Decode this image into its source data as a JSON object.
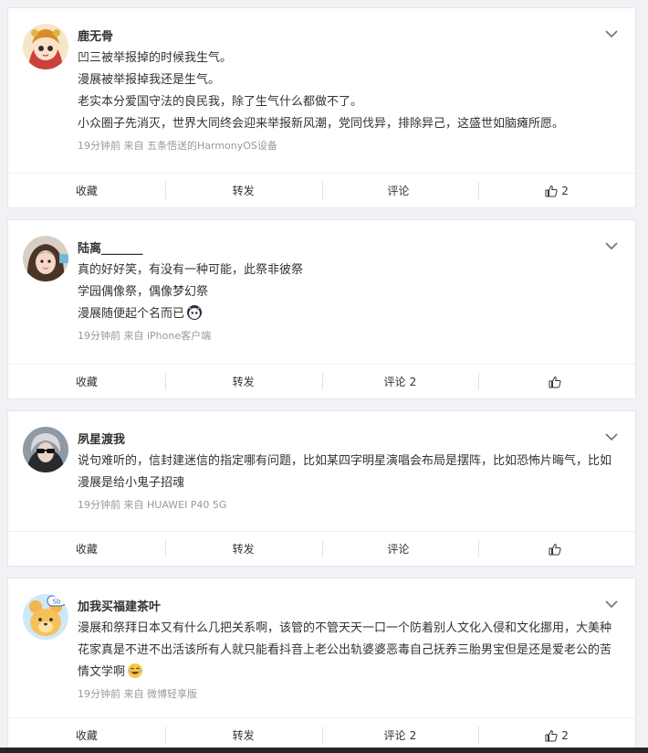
{
  "comments": [
    {
      "name": "鹿无骨",
      "lines": [
        "凹三被举报掉的时候我生气。",
        "漫展被举报掉我还是生气。",
        "老实本分爱国守法的良民我，除了生气什么都做不了。",
        "小众圈子先消灭，世界大同终会迎来举报新风潮，党同伐异，排除异己，这盛世如脑瘫所愿。"
      ],
      "meta": "19分钟前   来自 五条悟送的HarmonyOS设备",
      "actions": {
        "collect": "收藏",
        "repost": "转发",
        "comment": "评论",
        "comment_count": "",
        "like_count": "2"
      }
    },
    {
      "name": "陆离_______",
      "lines": [
        "真的好好笑，有没有一种可能，此祭非彼祭",
        "学园偶像祭，偶像梦幻祭",
        "漫展随便起个名而已"
      ],
      "meta": "19分钟前   来自 iPhone客户端",
      "actions": {
        "collect": "收藏",
        "repost": "转发",
        "comment": "评论",
        "comment_count": "2",
        "like_count": ""
      }
    },
    {
      "name": "夙星渡我",
      "lines": [
        "说句难听的，信封建迷信的指定哪有问题，比如某四字明星演唱会布局是摆阵，比如恐怖片晦气，比如漫展是给小鬼子招魂"
      ],
      "meta": "19分钟前   来自 HUAWEI P40 5G",
      "actions": {
        "collect": "收藏",
        "repost": "转发",
        "comment": "评论",
        "comment_count": "",
        "like_count": ""
      }
    },
    {
      "name": "加我买福建茶叶",
      "lines": [
        "漫展和祭拜日本又有什么几把关系啊，该管的不管天天一口一个防着别人文化入侵和文化挪用，大美种花家真是不进不出活该所有人就只能看抖音上老公出轨婆婆恶毒自己抚养三胎男宝但是还是爱老公的苦情文学啊"
      ],
      "meta": "19分钟前   来自 微博轻享版",
      "actions": {
        "collect": "收藏",
        "repost": "转发",
        "comment": "评论",
        "comment_count": "2",
        "like_count": "2"
      }
    }
  ]
}
